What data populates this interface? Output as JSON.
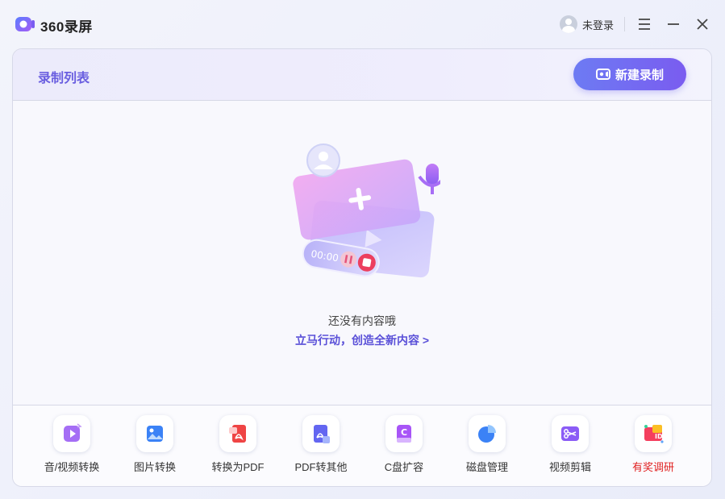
{
  "app": {
    "title": "360录屏"
  },
  "user": {
    "login_label": "未登录"
  },
  "card": {
    "title": "录制列表",
    "new_record_label": "新建录制"
  },
  "empty": {
    "message": "还没有内容哦",
    "action_label": "立马行动，创造全新内容 >",
    "timer": "00:00"
  },
  "tools": [
    {
      "label": "音/视频转换",
      "icon": "media-convert-icon",
      "color": "#8f5cf2"
    },
    {
      "label": "图片转换",
      "icon": "image-convert-icon",
      "color": "#3b82f6"
    },
    {
      "label": "转换为PDF",
      "icon": "to-pdf-icon",
      "color": "#ef4444"
    },
    {
      "label": "PDF转其他",
      "icon": "pdf-to-other-icon",
      "color": "#6366f1"
    },
    {
      "label": "C盘扩容",
      "icon": "c-drive-icon",
      "color": "#a855f7"
    },
    {
      "label": "磁盘管理",
      "icon": "disk-manage-icon",
      "color": "#3b82f6"
    },
    {
      "label": "视频剪辑",
      "icon": "video-edit-icon",
      "color": "#8b5cf6"
    },
    {
      "label": "有奖调研",
      "icon": "survey-icon",
      "color": "#e02020"
    }
  ],
  "colors": {
    "accent": "#6a5fe0",
    "button_gradient_start": "#6d7bf3",
    "button_gradient_end": "#7a5cf0",
    "survey_red": "#e02020"
  }
}
